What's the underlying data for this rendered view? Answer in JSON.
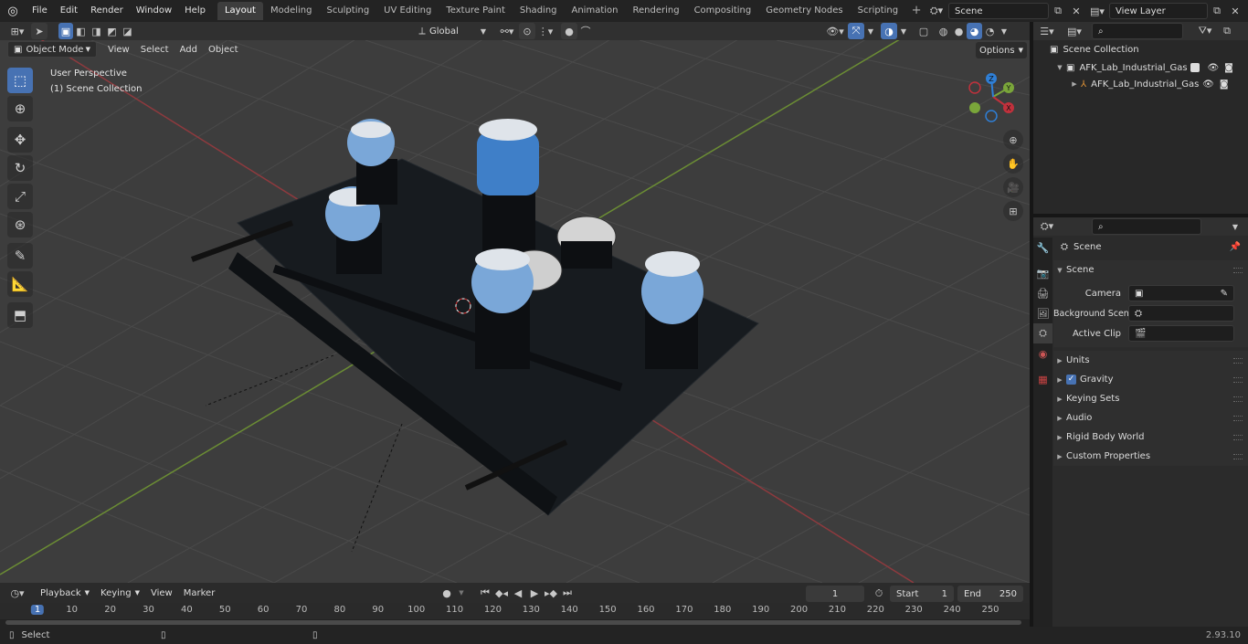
{
  "app": {
    "name": "Blender",
    "version": "2.93.10"
  },
  "topbar": {
    "menus": [
      "File",
      "Edit",
      "Render",
      "Window",
      "Help"
    ],
    "workspaces": [
      "Layout",
      "Modeling",
      "Sculpting",
      "UV Editing",
      "Texture Paint",
      "Shading",
      "Animation",
      "Rendering",
      "Compositing",
      "Geometry Nodes",
      "Scripting"
    ],
    "active_workspace": "Layout",
    "scene_name": "Scene",
    "view_layer": "View Layer"
  },
  "viewport_header": {
    "mode": "Object Mode",
    "menus": [
      "View",
      "Select",
      "Add",
      "Object"
    ],
    "transform_orientation": "Global",
    "options_label": "Options"
  },
  "viewport": {
    "perspective_label": "User Perspective",
    "collection_label": "(1) Scene Collection",
    "tools": [
      "select-box",
      "cursor",
      "move",
      "rotate",
      "scale",
      "transform",
      "annotate",
      "measure",
      "add-cube"
    ],
    "gizmo_axes": {
      "x": "X",
      "y": "Y",
      "z": "Z"
    },
    "colors": {
      "x_axis": "#c0313c",
      "y_axis": "#7aa63a",
      "z_axis": "#2f7fd6",
      "active_tool": "#4772b3"
    }
  },
  "outliner": {
    "root": "Scene Collection",
    "items": [
      {
        "label": "AFK_Lab_Industrial_Gas_Cont",
        "level": 1,
        "type": "collection"
      },
      {
        "label": "AFK_Lab_Industrial_Gas_(",
        "level": 2,
        "type": "object"
      }
    ]
  },
  "properties": {
    "context": "Scene",
    "section": "Scene",
    "fields": [
      {
        "label": "Camera",
        "value": ""
      },
      {
        "label": "Background Scene",
        "value": ""
      },
      {
        "label": "Active Clip",
        "value": ""
      }
    ],
    "panels": [
      {
        "label": "Units",
        "checkbox": false
      },
      {
        "label": "Gravity",
        "checkbox": true,
        "checked": true
      },
      {
        "label": "Keying Sets",
        "checkbox": false
      },
      {
        "label": "Audio",
        "checkbox": false
      },
      {
        "label": "Rigid Body World",
        "checkbox": false
      },
      {
        "label": "Custom Properties",
        "checkbox": false
      }
    ]
  },
  "timeline": {
    "menus": [
      "Playback",
      "Keying",
      "View",
      "Marker"
    ],
    "current_frame": "1",
    "start_label": "Start",
    "start": "1",
    "end_label": "End",
    "end": "250",
    "ruler": [
      "1",
      "10",
      "20",
      "30",
      "40",
      "50",
      "60",
      "70",
      "80",
      "90",
      "100",
      "110",
      "120",
      "130",
      "140",
      "150",
      "160",
      "170",
      "180",
      "190",
      "200",
      "210",
      "220",
      "230",
      "240",
      "250"
    ]
  },
  "status": {
    "left": "Select",
    "version": "2.93.10"
  }
}
